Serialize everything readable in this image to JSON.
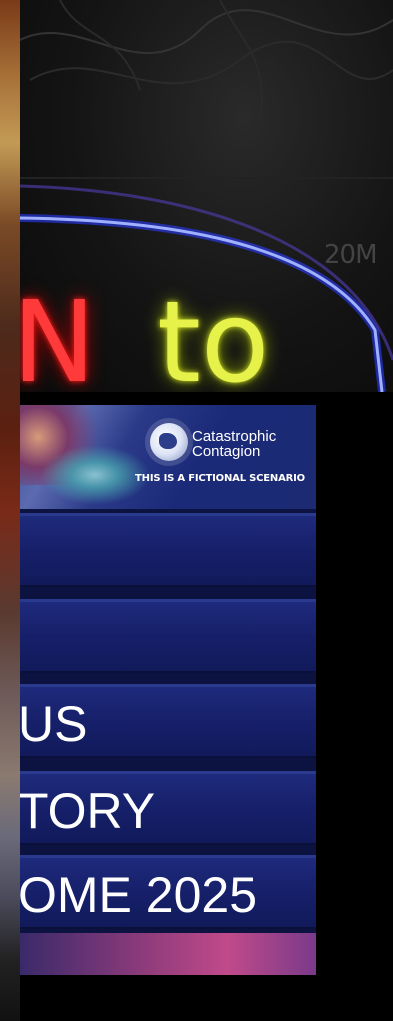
{
  "neon": {
    "word1": "N",
    "word2": "to",
    "small_text": "20M"
  },
  "menu": {
    "logo": {
      "title_line1": "Catastrophic",
      "title_line2": "Contagion",
      "tagline": "THIS IS A FICTIONAL SCENARIO"
    },
    "items": [
      {
        "label": ""
      },
      {
        "label": ""
      },
      {
        "label": "US"
      },
      {
        "label": "TORY"
      },
      {
        "label": "OME 2025"
      }
    ]
  },
  "colors": {
    "neon_red": "#ff3a3a",
    "neon_yellow": "#e6f24a",
    "neon_blue": "#4c6bff",
    "menu_bg": "#16206a"
  }
}
